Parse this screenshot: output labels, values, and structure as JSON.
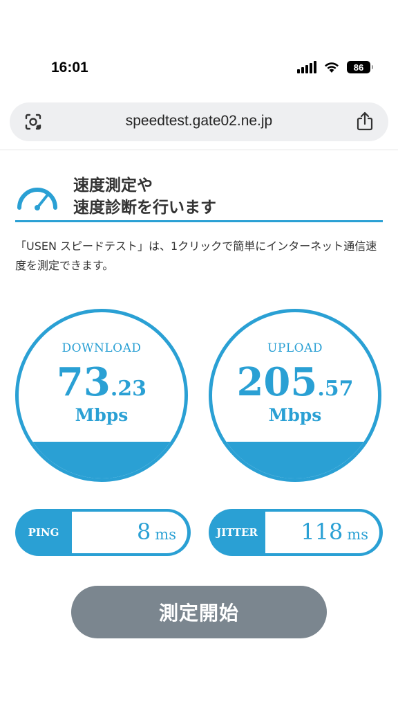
{
  "status_bar": {
    "time": "16:01",
    "battery": "86"
  },
  "browser": {
    "url": "speedtest.gate02.ne.jp"
  },
  "header": {
    "title_line1": "速度測定や",
    "title_line2": "速度診断を行います"
  },
  "description": "「USEN スピードテスト」は、1クリックで簡単にインターネット通信速度を測定できます。",
  "download": {
    "label": "DOWNLOAD",
    "value_int": "73",
    "value_dec": ".23",
    "unit": "Mbps"
  },
  "upload": {
    "label": "UPLOAD",
    "value_int": "205",
    "value_dec": ".57",
    "unit": "Mbps"
  },
  "ping": {
    "label": "PING",
    "value": "8",
    "unit": "ms"
  },
  "jitter": {
    "label": "JITTER",
    "value": "118",
    "unit": "ms"
  },
  "start_button": {
    "label": "測定開始"
  },
  "colors": {
    "accent": "#2aa0d4",
    "button_gray": "#7b868f",
    "url_bar_bg": "#eeeff1"
  },
  "gauge_fill_fraction": 0.22
}
